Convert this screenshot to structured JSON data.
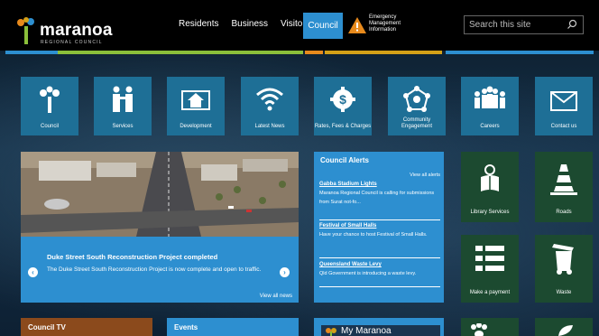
{
  "header": {
    "logo": {
      "name": "maranoa",
      "sub": "REGIONAL COUNCIL"
    },
    "nav": [
      {
        "label": "Residents"
      },
      {
        "label": "Business"
      },
      {
        "label": "Visitors"
      }
    ],
    "active_nav": {
      "label": "Council"
    },
    "emergency": {
      "line1": "Emergency",
      "line2": "Management",
      "line3": "Information"
    },
    "search": {
      "placeholder": "Search this site",
      "value": ""
    }
  },
  "colors": {
    "header_bg": "#000000",
    "tile_blue": "#1e6f96",
    "accent_blue": "#2d8fd0",
    "tile_green": "#1c4a30",
    "tv_brown": "#8b4a1c",
    "strip_colors": [
      "#2d8fd0",
      "#8bbf3a",
      "#e88a1c",
      "#d4a017",
      "#2d8fd0"
    ]
  },
  "tiles": [
    {
      "label": "Council",
      "icon": "council-tree-icon"
    },
    {
      "label": "Services",
      "icon": "people-icon"
    },
    {
      "label": "Development",
      "icon": "house-blueprint-icon"
    },
    {
      "label": "Latest News",
      "icon": "wifi-icon"
    },
    {
      "label": "Rates, Fees & Charges",
      "icon": "dollar-gear-icon"
    },
    {
      "label": "Community Engagement",
      "icon": "community-network-icon"
    },
    {
      "label": "Careers",
      "icon": "group-people-icon"
    },
    {
      "label": "Contact us",
      "icon": "envelope-icon"
    }
  ],
  "hero": {
    "title": "Duke Street South Reconstruction Project completed",
    "description": "The Duke Street South Reconstruction Project is now complete and open to traffic.",
    "view_all": "View all news"
  },
  "alerts": {
    "title": "Council Alerts",
    "view_all": "View all alerts",
    "items": [
      {
        "title": "Gabba Stadium Lights",
        "body": "Maranoa Regional Council is calling for submissions from Surat not-fo..."
      },
      {
        "title": "Festival of Small Halls",
        "body": "Have your chance to host Festival of Small Halls."
      },
      {
        "title": "Queensland Waste Levy",
        "body": "Qld Government is introducing a waste levy."
      }
    ]
  },
  "green_tiles": [
    {
      "label": "Library Services",
      "icon": "reader-icon"
    },
    {
      "label": "Roads",
      "icon": "traffic-cone-icon"
    },
    {
      "label": "Make a payment",
      "icon": "list-icon"
    },
    {
      "label": "Waste",
      "icon": "wheelie-bin-icon"
    }
  ],
  "bottom": {
    "council_tv": "Council TV",
    "events": "Events",
    "my_maranoa": "My Maranoa"
  }
}
